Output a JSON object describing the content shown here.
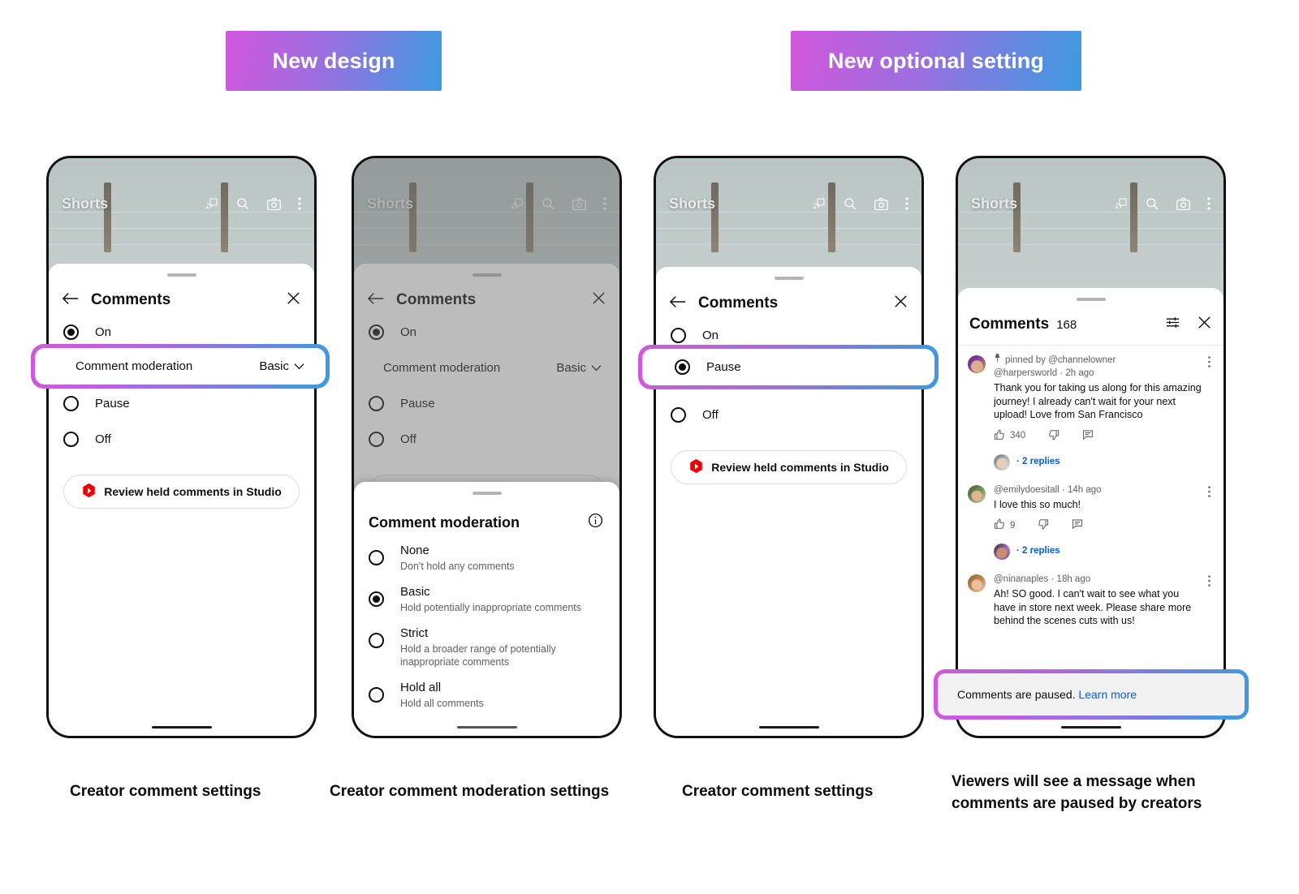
{
  "banners": [
    {
      "label": "New design"
    },
    {
      "label": "New optional setting"
    }
  ],
  "shorts": {
    "title": "Shorts",
    "icons": [
      "cast-icon",
      "search-icon",
      "camera-icon",
      "kebab-menu-icon"
    ]
  },
  "phone1": {
    "sheet": {
      "title": "Comments",
      "back": "back-arrow-icon",
      "close": "close-icon",
      "options": [
        {
          "label": "On",
          "selected": true
        },
        {
          "label": "Pause",
          "selected": false
        },
        {
          "label": "Off",
          "selected": false
        }
      ],
      "moderation": {
        "label": "Comment moderation",
        "value": "Basic"
      },
      "studio_button": "Review held comments in Studio"
    }
  },
  "phone2": {
    "sheet": {
      "title": "Comments",
      "options": [
        {
          "label": "On",
          "selected": true
        },
        {
          "label": "Pause",
          "selected": false
        },
        {
          "label": "Off",
          "selected": false
        }
      ],
      "moderation": {
        "label": "Comment moderation",
        "value": "Basic"
      }
    },
    "modal": {
      "title": "Comment moderation",
      "info_icon": "info-icon",
      "options": [
        {
          "name": "None",
          "desc": "Don't hold any comments",
          "selected": false
        },
        {
          "name": "Basic",
          "desc": "Hold potentially inappropriate comments",
          "selected": true
        },
        {
          "name": "Strict",
          "desc": "Hold a broader range of potentially inappropriate comments",
          "selected": false
        },
        {
          "name": "Hold all",
          "desc": "Hold all comments",
          "selected": false
        }
      ]
    }
  },
  "phone3": {
    "sheet": {
      "title": "Comments",
      "options": [
        {
          "label": "On",
          "selected": false
        },
        {
          "label": "Pause",
          "selected": true
        },
        {
          "label": "Off",
          "selected": false
        }
      ],
      "studio_button": "Review held comments in Studio"
    }
  },
  "phone4": {
    "header": {
      "title": "Comments",
      "count": "168",
      "filter_icon": "sliders-icon",
      "close_icon": "close-icon"
    },
    "comments": [
      {
        "pinned_label": "pinned by @channelowner",
        "author": "@harpersworld",
        "time": "2h ago",
        "text": "Thank you for taking us along for this amazing journey! I already can't wait for your next upload! Love from San Francisco",
        "likes": "340",
        "replies": "2 replies"
      },
      {
        "author": "@emilydoesitall",
        "time": "14h ago",
        "text": "I love this so much!",
        "likes": "9",
        "replies": "2 replies"
      },
      {
        "author": "@ninanaples",
        "time": "18h ago",
        "text": "Ah! SO good. I can't wait to see what you have in store next week. Please share more behind the scenes cuts with us!"
      }
    ],
    "paused_banner": {
      "text": "Comments are paused.",
      "link": "Learn more"
    }
  },
  "captions": [
    "Creator comment settings",
    "Creator comment moderation settings",
    "Creator comment settings",
    "Viewers will see a message when comments are paused by creators"
  ],
  "colors": {
    "gradient_start": "#d257dd",
    "gradient_end": "#3d9ae0",
    "link": "#065fd4",
    "youtube_red": "#ef0000"
  }
}
